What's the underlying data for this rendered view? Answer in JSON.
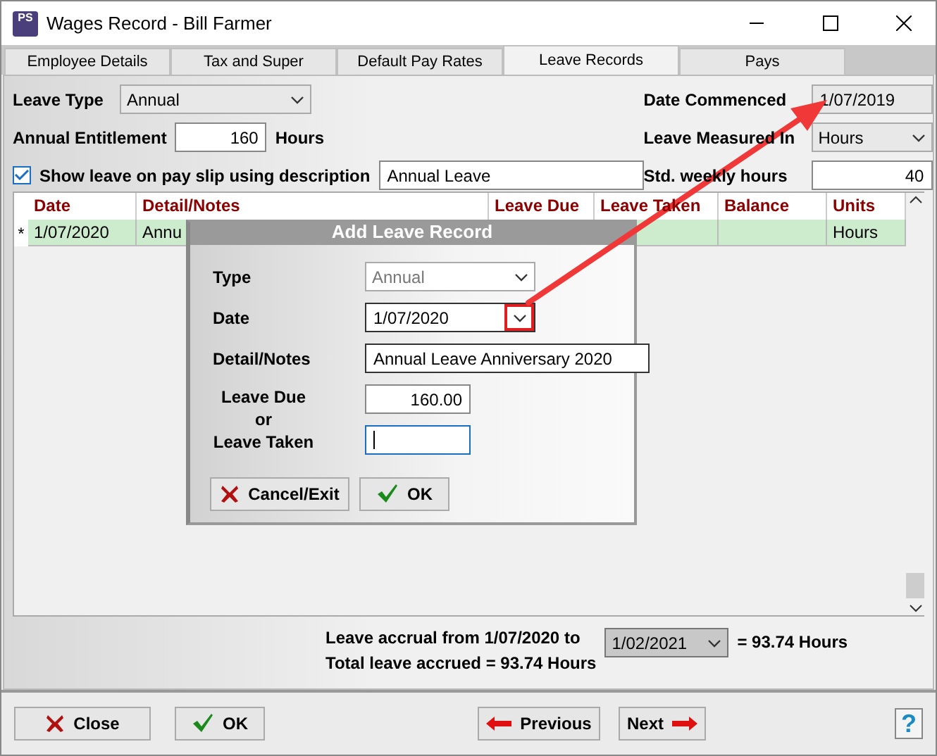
{
  "window": {
    "title": "Wages Record - Bill Farmer",
    "app_icon": "PS"
  },
  "tabs": [
    {
      "label": "Employee Details",
      "selected": false
    },
    {
      "label": "Tax and Super",
      "selected": false
    },
    {
      "label": "Default Pay Rates",
      "selected": false
    },
    {
      "label": "Leave Records",
      "selected": true
    },
    {
      "label": "Pays",
      "selected": false
    }
  ],
  "form": {
    "leave_type_label": "Leave Type",
    "leave_type": "Annual",
    "entitlement_label": "Annual Entitlement",
    "entitlement": "160",
    "entitlement_unit": "Hours",
    "show_on_slip_label": "Show leave on pay slip using description",
    "show_on_slip": true,
    "slip_description": "Annual Leave",
    "date_commenced_label": "Date Commenced",
    "date_commenced": "1/07/2019",
    "measured_in_label": "Leave Measured In",
    "measured_in": "Hours",
    "weekly_hours_label": "Std. weekly hours",
    "weekly_hours": "40"
  },
  "table": {
    "columns": [
      "Date",
      "Detail/Notes",
      "Leave Due",
      "Leave Taken",
      "Balance",
      "Units"
    ],
    "rows": [
      {
        "marker": "*",
        "date": "1/07/2020",
        "detail": "Annu",
        "units": "Hours"
      }
    ]
  },
  "accrual": {
    "from_label": "Leave accrual from 1/07/2020 to",
    "to_date": "1/02/2021",
    "result": "= 93.74 Hours",
    "total": "Total leave accrued = 93.74 Hours"
  },
  "dialog": {
    "title": "Add Leave Record",
    "type_label": "Type",
    "type": "Annual",
    "type_disabled": true,
    "date_label": "Date",
    "date": "1/07/2020",
    "notes_label": "Detail/Notes",
    "notes": "Annual Leave Anniversary 2020",
    "due_label": "Leave Due",
    "or_label": "or",
    "taken_label": "Leave Taken",
    "due": "160.00",
    "cancel": "Cancel/Exit",
    "ok": "OK"
  },
  "buttons": {
    "close": "Close",
    "ok": "OK",
    "previous": "Previous",
    "next": "Next",
    "help": "?"
  }
}
